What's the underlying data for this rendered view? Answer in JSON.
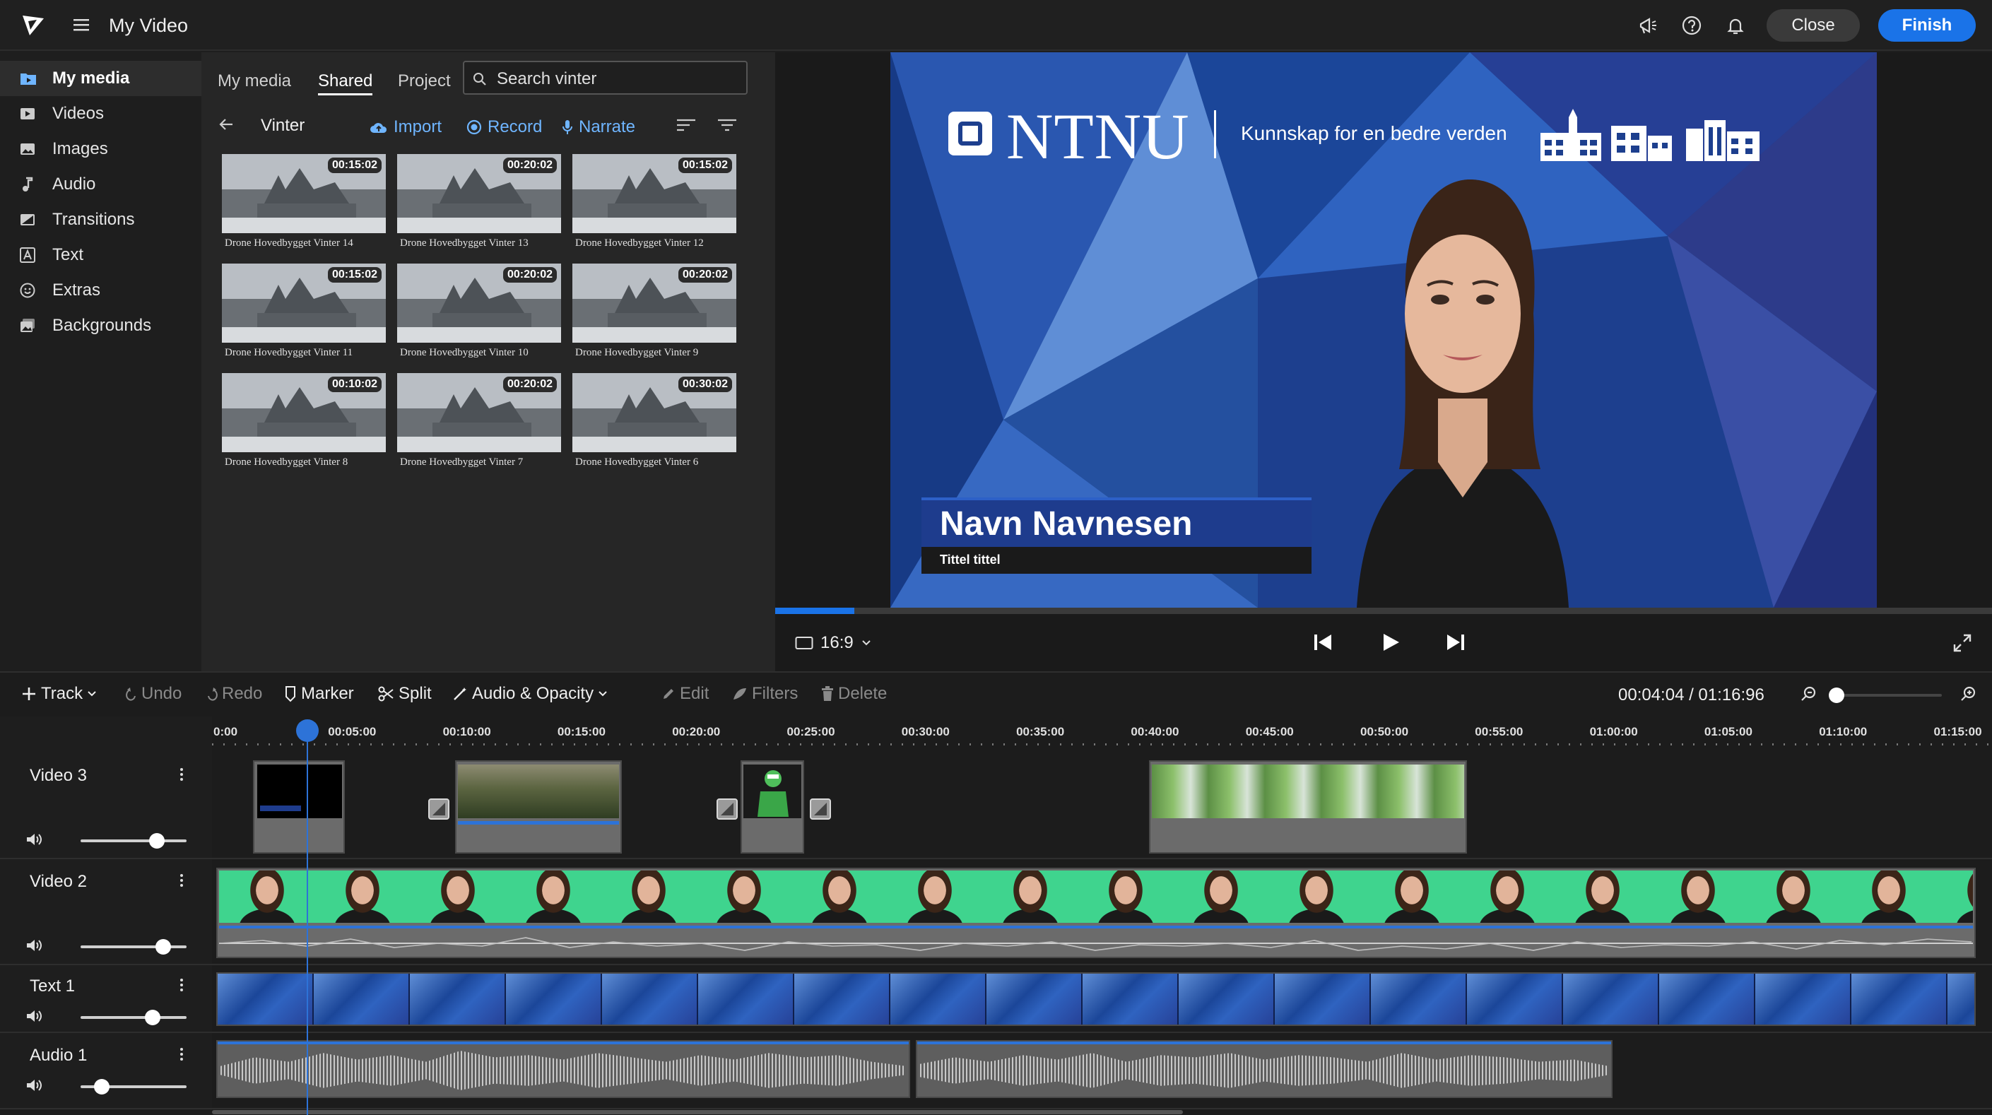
{
  "app": {
    "title": "My Video",
    "close_label": "Close",
    "finish_label": "Finish"
  },
  "sidebar": {
    "items": [
      {
        "label": "My media",
        "icon": "folder-media-icon",
        "active": true
      },
      {
        "label": "Videos",
        "icon": "video-icon"
      },
      {
        "label": "Images",
        "icon": "image-icon"
      },
      {
        "label": "Audio",
        "icon": "music-note-icon"
      },
      {
        "label": "Transitions",
        "icon": "transition-icon"
      },
      {
        "label": "Text",
        "icon": "text-icon"
      },
      {
        "label": "Extras",
        "icon": "smiley-icon"
      },
      {
        "label": "Backgrounds",
        "icon": "background-icon"
      }
    ]
  },
  "media": {
    "tabs": [
      "My media",
      "Shared",
      "Project"
    ],
    "active_tab": "Shared",
    "search_placeholder": "Search vinter",
    "folder": "Vinter",
    "actions": {
      "import": "Import",
      "record": "Record",
      "narrate": "Narrate"
    },
    "thumbnails": [
      {
        "duration": "00:15:02",
        "caption": "Drone Hovedbygget Vinter 14"
      },
      {
        "duration": "00:20:02",
        "caption": "Drone Hovedbygget Vinter 13"
      },
      {
        "duration": "00:15:02",
        "caption": "Drone Hovedbygget Vinter 12"
      },
      {
        "duration": "00:15:02",
        "caption": "Drone Hovedbygget Vinter 11"
      },
      {
        "duration": "00:20:02",
        "caption": "Drone Hovedbygget Vinter 10"
      },
      {
        "duration": "00:20:02",
        "caption": "Drone Hovedbygget Vinter 9"
      },
      {
        "duration": "00:10:02",
        "caption": "Drone Hovedbygget Vinter 8"
      },
      {
        "duration": "00:20:02",
        "caption": "Drone Hovedbygget Vinter 7"
      },
      {
        "duration": "00:30:02",
        "caption": "Drone Hovedbygget Vinter 6"
      }
    ]
  },
  "preview": {
    "logo_text": "NTNU",
    "tagline": "Kunnskap for en bedre verden",
    "lower_third_name": "Navn Navnesen",
    "lower_third_title": "Tittel tittel",
    "aspect_ratio": "16:9",
    "progress": 0.065
  },
  "timeline": {
    "tools": {
      "track": "Track",
      "undo": "Undo",
      "redo": "Redo",
      "marker": "Marker",
      "split": "Split",
      "audio_opacity": "Audio & Opacity",
      "edit": "Edit",
      "filters": "Filters",
      "delete": "Delete"
    },
    "timecode": "00:04:04 / 01:16:96",
    "ticks": [
      "0:00",
      "00:05:00",
      "00:10:00",
      "00:15:00",
      "00:20:00",
      "00:25:00",
      "00:30:00",
      "00:35:00",
      "00:40:00",
      "00:45:00",
      "00:50:00",
      "00:55:00",
      "01:00:00",
      "01:05:00",
      "01:10:00",
      "01:15:00"
    ],
    "tracks": [
      {
        "name": "Video 3",
        "volume": 0.72
      },
      {
        "name": "Video 2",
        "volume": 0.78
      },
      {
        "name": "Text 1",
        "volume": 0.68
      },
      {
        "name": "Audio 1",
        "volume": 0.2
      }
    ]
  },
  "colors": {
    "accent": "#1a73e8",
    "link": "#6fb5ff",
    "green_screen": "#3fd48e"
  }
}
